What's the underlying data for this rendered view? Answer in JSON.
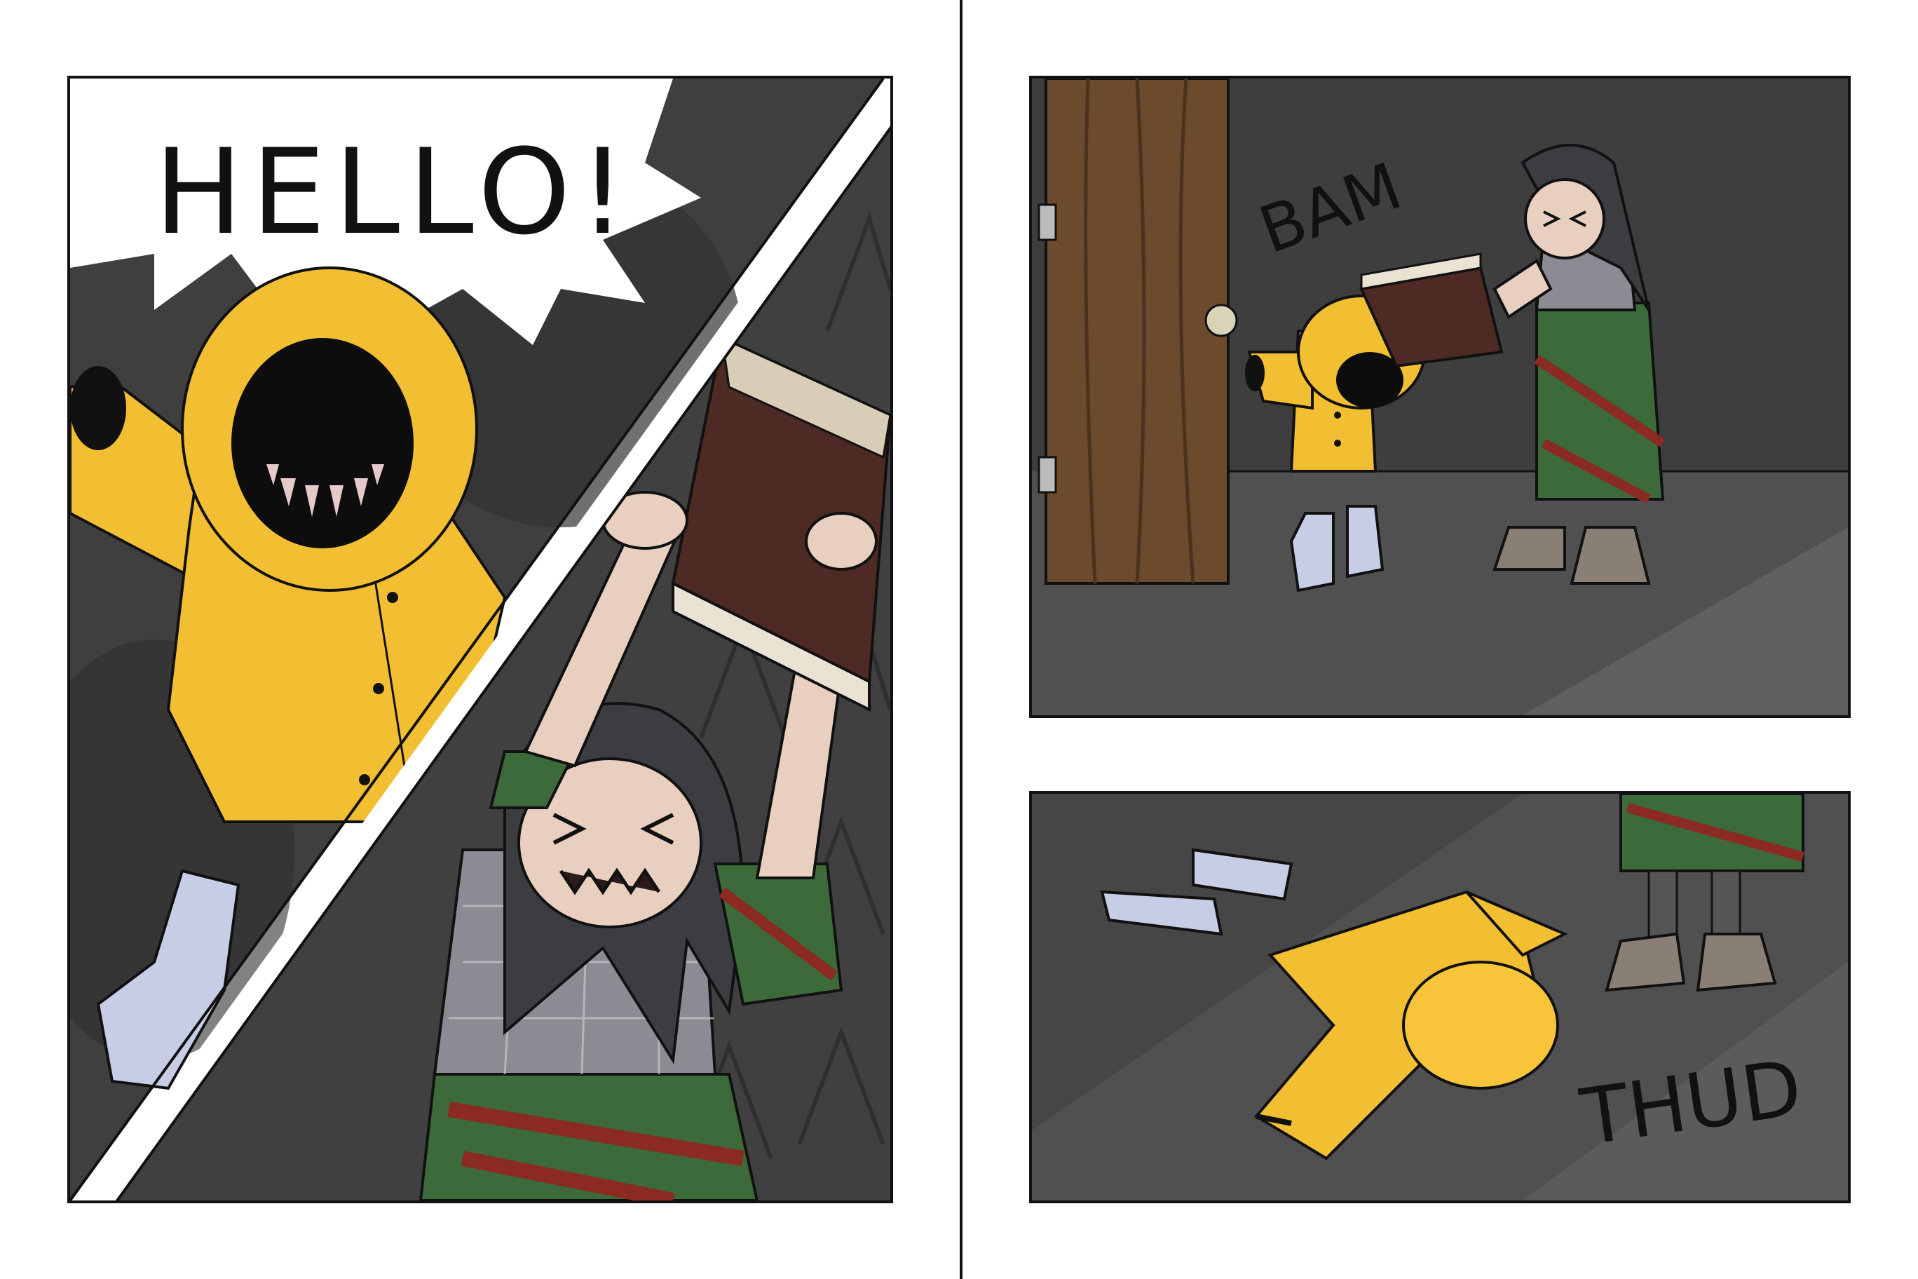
{
  "panel_1": {
    "speech_bubble": "HELLO!"
  },
  "panel_3": {
    "sfx": "BAM"
  },
  "panel_4": {
    "sfx": "THUD"
  },
  "colors": {
    "raincoat": "#f2be32",
    "boots": "#c8cde6",
    "wall_dark": "#3e3e3e",
    "floor": "#505050",
    "door": "#6b4a2e",
    "book": "#4e2a24",
    "skirt_green": "#3d6a3a",
    "skirt_red": "#8a2a22"
  }
}
